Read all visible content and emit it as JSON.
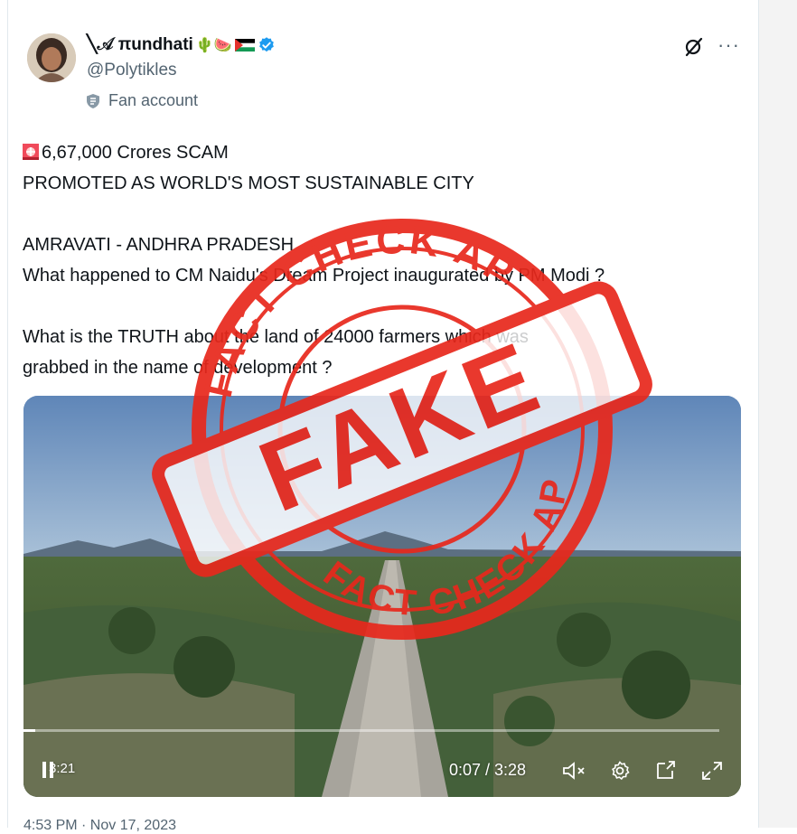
{
  "author": {
    "display_name": "╲𝒜 πundhati",
    "emojis": "🌵🍉",
    "handle": "@Polytikles",
    "label": "Fan account"
  },
  "tweet": {
    "line1": "6,67,000 Crores SCAM",
    "line2": "PROMOTED AS WORLD'S MOST SUSTAINABLE CITY",
    "line3": "AMRAVATI - ANDHRA PRADESH",
    "line4": "What happened to CM Naidu's Dream Project inaugurated by PM Modi ?",
    "line5": "What is the TRUTH about the land of 24000 farmers which was",
    "line6": "grabbed in the name of development ?"
  },
  "video": {
    "elapsed": "0:07",
    "duration": "3:28",
    "time_display": "0:07 / 3:28",
    "corner_text": "3:21",
    "progress_fraction": 0.034
  },
  "stamp": {
    "main": "FAKE",
    "ring_text_top": "FACT CHECK AP",
    "ring_text_bottom": "FACT CHECK AP",
    "color": "#e8281c"
  },
  "footer": {
    "timestamp_partial": "4:53 PM · Nov 17, 2023"
  },
  "colors": {
    "verified": "#1d9bf0",
    "text": "#0f1419",
    "secondary": "#536471"
  }
}
